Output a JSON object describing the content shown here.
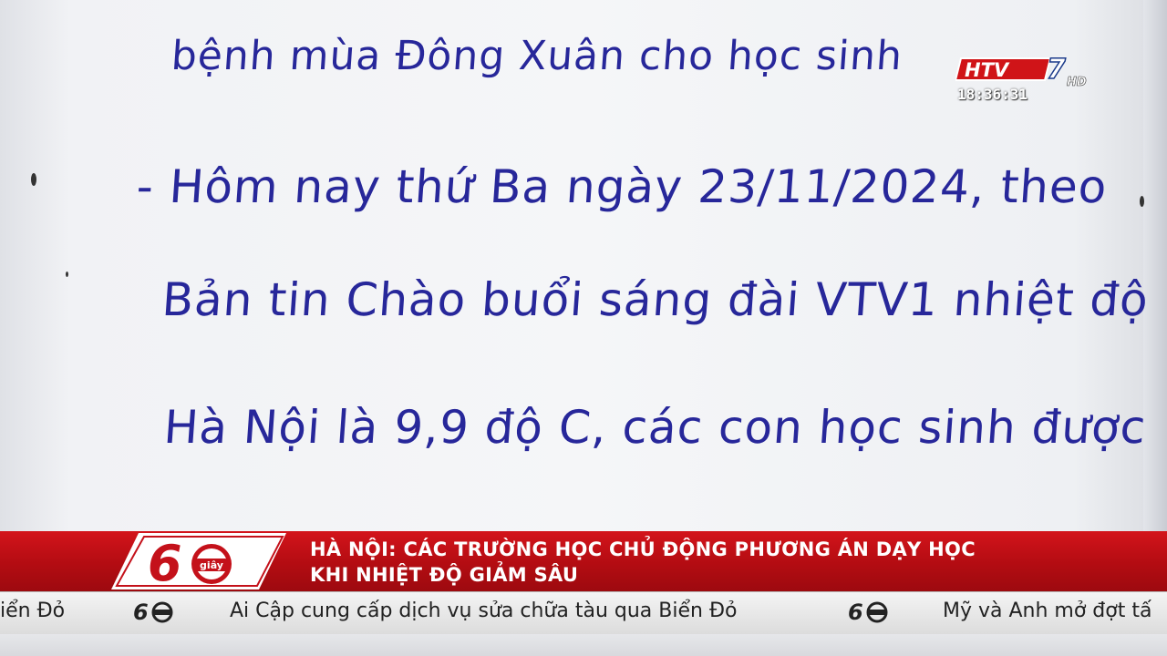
{
  "board": {
    "lines": [
      "bệnh mùa Đông Xuân cho học sinh",
      "- Hôm nay thứ Ba ngày 23/11/2024, theo",
      "Bản tin Chào buổi sáng đài VTV1 nhiệt độ",
      "Hà Nội là 9,9 độ C, các con học sinh được"
    ]
  },
  "channel": {
    "logo_text": "HTV7",
    "hd_label": "HD",
    "clock": "18:36:31"
  },
  "program": {
    "badge_number": "60",
    "badge_unit": "giây"
  },
  "headline": {
    "line1": "HÀ NỘI: CÁC TRƯỜNG HỌC CHỦ ĐỘNG PHƯƠNG ÁN DẠY HỌC",
    "line2": "KHI NHIỆT ĐỘ GIẢM SÂU"
  },
  "ticker": {
    "items": [
      "iển Đỏ",
      "Ai Cập cung cấp dịch vụ sửa chữa tàu qua Biển Đỏ",
      "Mỹ và Anh mở đợt tấ"
    ]
  },
  "colors": {
    "handwriting": "#27279a",
    "headline_red": "#c4111a",
    "ticker_bg": "#ececec"
  }
}
